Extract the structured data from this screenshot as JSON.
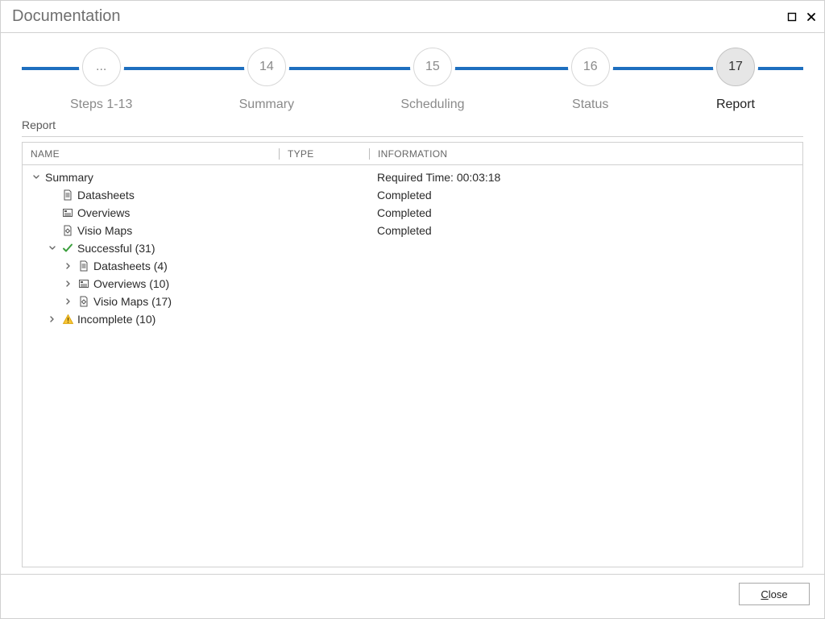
{
  "window": {
    "title": "Documentation"
  },
  "stepper": {
    "steps": [
      {
        "num": "...",
        "label": "Steps 1-13",
        "active": false
      },
      {
        "num": "14",
        "label": "Summary",
        "active": false
      },
      {
        "num": "15",
        "label": "Scheduling",
        "active": false
      },
      {
        "num": "16",
        "label": "Status",
        "active": false
      },
      {
        "num": "17",
        "label": "Report",
        "active": true
      }
    ]
  },
  "section": {
    "heading": "Report"
  },
  "table": {
    "headers": {
      "name": "NAME",
      "type": "TYPE",
      "info": "INFORMATION"
    },
    "rows": [
      {
        "indent": 1,
        "expander": "down",
        "icon": "",
        "name": "Summary",
        "info": "Required Time: 00:03:18"
      },
      {
        "indent": 2,
        "expander": "",
        "icon": "datasheet",
        "name": "Datasheets",
        "info": "Completed"
      },
      {
        "indent": 2,
        "expander": "",
        "icon": "overview",
        "name": "Overviews",
        "info": "Completed"
      },
      {
        "indent": 2,
        "expander": "",
        "icon": "visio",
        "name": "Visio Maps",
        "info": "Completed"
      },
      {
        "indent": 2,
        "expander": "down",
        "icon": "check",
        "name": "Successful (31)",
        "info": ""
      },
      {
        "indent": 3,
        "expander": "right",
        "icon": "datasheet",
        "name": "Datasheets (4)",
        "info": ""
      },
      {
        "indent": 3,
        "expander": "right",
        "icon": "overview",
        "name": "Overviews (10)",
        "info": ""
      },
      {
        "indent": 3,
        "expander": "right",
        "icon": "visio",
        "name": "Visio Maps (17)",
        "info": ""
      },
      {
        "indent": 2,
        "expander": "right",
        "icon": "warn",
        "name": "Incomplete (10)",
        "info": ""
      }
    ]
  },
  "footer": {
    "close": "Close"
  }
}
